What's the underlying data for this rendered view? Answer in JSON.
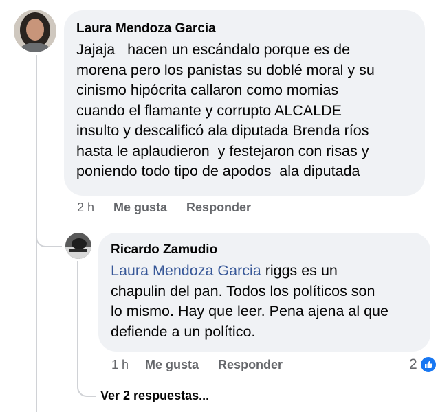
{
  "comment": {
    "author": "Laura Mendoza Garcia",
    "lines": [
      "Jajaja   hacen un escándalo porque es de",
      "morena pero los panistas su doblé moral y su",
      "cinismo hipócrita callaron como momias",
      "cuando el flamante y corrupto ALCALDE",
      "insulto y descalificó ala diputada Brenda ríos",
      "hasta le aplaudieron  y festejaron con risas y",
      "poniendo todo tipo de apodos  ala diputada"
    ],
    "time": "2 h",
    "like_label": "Me gusta",
    "reply_label": "Responder"
  },
  "reply": {
    "author": "Ricardo Zamudio",
    "mention": "Laura Mendoza Garcia",
    "line1_rest": " riggs es un",
    "lines": [
      "chapulin del pan. Todos los políticos son",
      "lo mismo. Hay que leer. Pena ajena al que",
      "defiende a un político."
    ],
    "time": "1 h",
    "like_label": "Me gusta",
    "reply_label": "Responder",
    "reaction_count": "2"
  },
  "see_more_replies": "Ver 2 respuestas...",
  "colors": {
    "bubble": "#f0f2f5",
    "mention": "#385898",
    "meta": "#65676b",
    "like_blue": "#1877f2"
  }
}
